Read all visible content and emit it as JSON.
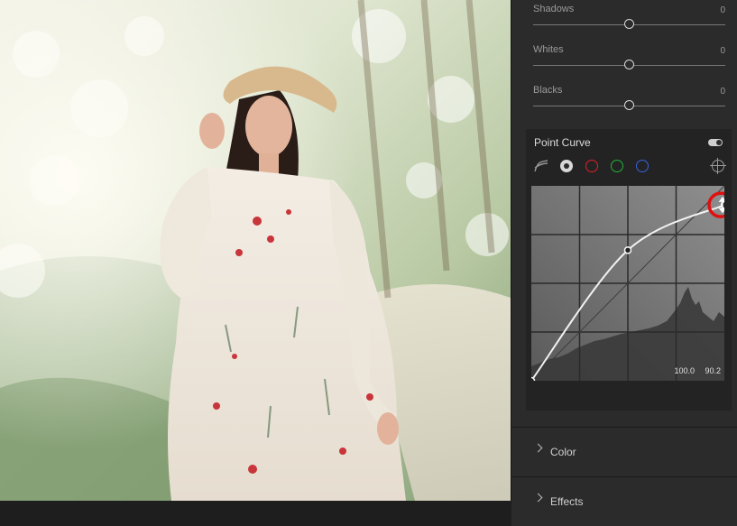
{
  "sliders": [
    {
      "label": "Shadows",
      "value": "0",
      "level": 0
    },
    {
      "label": "Whites",
      "value": "0",
      "level": 0
    },
    {
      "label": "Blacks",
      "value": "0",
      "level": 0
    }
  ],
  "point_curve": {
    "title": "Point Curve",
    "enabled": true,
    "channels": [
      "parametric-curve-icon",
      "rgb-channel",
      "red-channel",
      "green-channel",
      "blue-channel"
    ],
    "channel_colors": {
      "rgb": "#dcdcdc",
      "red": "#e0202a",
      "green": "#22b43a",
      "blue": "#3a62e0"
    },
    "point_readout": {
      "input": "100.0",
      "output": "90.2"
    },
    "points": [
      [
        0,
        0
      ],
      [
        50,
        67
      ],
      [
        100,
        90.2
      ]
    ],
    "highlight_color": "#e01010"
  },
  "sections": [
    {
      "label": "Color"
    },
    {
      "label": "Effects"
    }
  ]
}
